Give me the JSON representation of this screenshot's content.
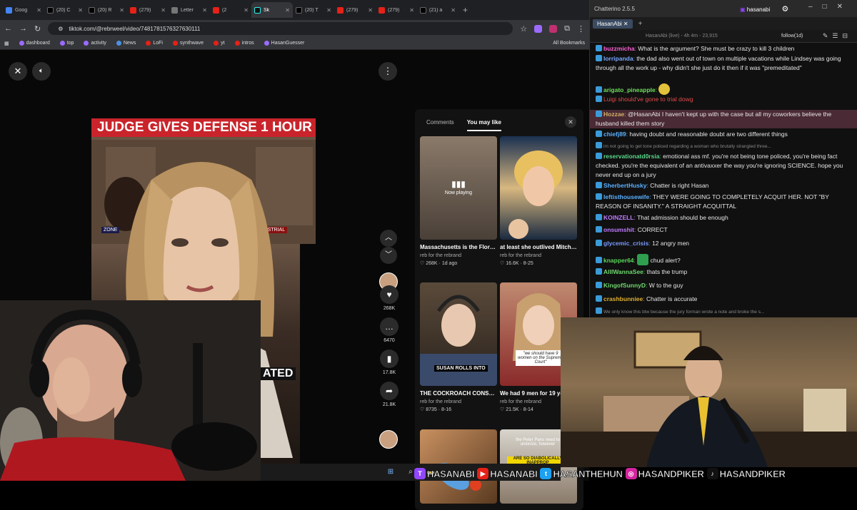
{
  "browser": {
    "tabs": [
      {
        "label": "Goog",
        "fav": "g",
        "icon": "google-icon",
        "active": false
      },
      {
        "label": "(20) C",
        "fav": "x",
        "icon": "x-icon",
        "active": false
      },
      {
        "label": "(20) R",
        "fav": "x",
        "icon": "x-icon",
        "active": false
      },
      {
        "label": "(279)",
        "fav": "yt",
        "icon": "youtube-icon",
        "active": false
      },
      {
        "label": "Letter",
        "fav": "lt",
        "icon": "page-icon",
        "active": false
      },
      {
        "label": "(2",
        "fav": "yt",
        "icon": "youtube-icon",
        "active": false
      },
      {
        "label": "Sk",
        "fav": "tt",
        "icon": "tiktok-icon",
        "active": true
      },
      {
        "label": "(20) T",
        "fav": "x",
        "icon": "x-icon",
        "active": false
      },
      {
        "label": "(279)",
        "fav": "yt",
        "icon": "youtube-icon",
        "active": false
      },
      {
        "label": "(279)",
        "fav": "yt",
        "icon": "youtube-icon",
        "active": false
      },
      {
        "label": "(21) a",
        "fav": "x",
        "icon": "x-icon",
        "active": false
      }
    ],
    "new_tab": "+",
    "url": "tiktok.com/@rebrweel/video/7481781576327630111",
    "bookmarks": [
      {
        "label": "dashboard",
        "color": "#9b6bff"
      },
      {
        "label": "top",
        "color": "#9b6bff"
      },
      {
        "label": "activity",
        "color": "#9b6bff"
      },
      {
        "label": "News",
        "color": "#4a90e2"
      },
      {
        "label": "LoFi",
        "color": "#e62117"
      },
      {
        "label": "synthwave",
        "color": "#e62117"
      },
      {
        "label": "yt",
        "color": "#e62117"
      },
      {
        "label": "intros",
        "color": "#e62117"
      },
      {
        "label": "HasanGuesser",
        "color": "#9b6bff"
      }
    ],
    "all_bookmarks": "All Bookmarks"
  },
  "tiktok": {
    "headline": "JUDGE GIVES DEFENSE 1 HOUR",
    "chyron_left": "ZONE",
    "chyron_right": "ENT MISTRIAL",
    "caption": "ATED",
    "actions": [
      {
        "icon": "heart-icon",
        "count": "268K"
      },
      {
        "icon": "comment-icon",
        "count": "6470"
      },
      {
        "icon": "bookmark-icon",
        "count": "17.8K"
      },
      {
        "icon": "share-icon",
        "count": "21.8K"
      }
    ],
    "panel": {
      "tab_comments": "Comments",
      "tab_you_may_like": "You may like",
      "now_playing": "Now playing",
      "cards": [
        {
          "title": "Massachusetts is the Florida man of crimin...",
          "author": "reb for the rebrand",
          "likes": "268K",
          "date": "1d ago"
        },
        {
          "title": "at least she outlived Mitch McConnell let's...",
          "author": "reb for the rebrand",
          "likes": "16.6K",
          "date": "8-25"
        },
        {
          "title": "THE COCKROACH CONSPIRACY CASE...",
          "author": "reb for the rebrand",
          "likes": "8735",
          "date": "8-16"
        },
        {
          "title": "We had 9 men for 19 years (until 1981)...",
          "author": "reb for the rebrand",
          "likes": "21.5K",
          "date": "8-14"
        }
      ],
      "thumb_texts": {
        "susan": "SUSAN ROLLS INTO",
        "supreme": "\"we should have 9 women on the Supreme Court\"",
        "peter": "the Peter Pans need to unionize, however",
        "diabolical": "ARE SO DIABOLICALLY INAPPROP"
      }
    }
  },
  "chat": {
    "app_title": "Chatterino 2.5.5",
    "user": "hasanabi",
    "tab": "HasanAbi",
    "stream_info": "HasanAbi (live) - 4h 4m - 23,915",
    "follow": "follow(1d)",
    "messages": [
      {
        "user": "buzzmicha",
        "color": "#ff5fd7",
        "text": "What is the argument? She must be crazy to kill 3 children"
      },
      {
        "user": "lorripanda",
        "color": "#7aa7ff",
        "text": "the dad also went out of town on multiple vacations while Lindsey was going through all the work up - why didn't she just do it then if it was \"premeditated\""
      },
      {
        "user": "arigato_pineapple",
        "color": "#6de05b",
        "text": ""
      },
      {
        "user": "",
        "color": "#e04b4b",
        "text": "Luigi should've gone to trial dowg"
      },
      {
        "user": "Hozzae",
        "color": "#d4b06a",
        "text": "@HasanAbi I haven't kept up with the case but all my coworkers believe the husband killed them story"
      },
      {
        "user": "chiefj89",
        "color": "#5ab0ff",
        "text": "having doubt and reasonable doubt are two different things"
      },
      {
        "user": "",
        "color": "#888888",
        "text": "im not going to get tone policed regarding a woman who brutally strangled three..."
      },
      {
        "user": "reservationatd0rsia",
        "color": "#5ad88a",
        "text": "emotional ass mf. you're not being tone policed, you're being fact checked. you're the equivalent of an antivaxxer the way you're ignoring SCIENCE. hope you never end up on a jury"
      },
      {
        "user": "SherbertHusky",
        "color": "#5ab0ff",
        "text": "Chatter is right Hasan"
      },
      {
        "user": "leftisthousewife",
        "color": "#5ab0ff",
        "text": "THEY WERE GOING TO COMPLETELY ACQUIT HER. NOT \"BY REASON OF INSANITY.\" A STRAIGHT ACQUITTAL"
      },
      {
        "user": "KOINZELL",
        "color": "#c07aff",
        "text": "That admission should be enough"
      },
      {
        "user": "onsumshit",
        "color": "#c07aff",
        "text": "CORRECT"
      },
      {
        "user": "glycemic_crisis",
        "color": "#7a9aff",
        "text": "12 angry men"
      },
      {
        "user": "knapper64",
        "color": "#5ad85a",
        "text": "chud alert?"
      },
      {
        "user": "AllIWannaSee",
        "color": "#6ed86e",
        "text": "thats the trump"
      },
      {
        "user": "KingofSunnyD",
        "color": "#6ed86e",
        "text": "W to the guy"
      },
      {
        "user": "crashbunniee",
        "color": "#e0b030",
        "text": "Chatter is accurate"
      },
      {
        "user": "",
        "color": "#888888",
        "text": "We only know this btw because the jury forman wrote a note and broke the s..."
      }
    ]
  },
  "socials": [
    {
      "icon": "twitch-icon",
      "glyph": "T",
      "color": "#9146ff",
      "name": "HASANABI"
    },
    {
      "icon": "youtube-icon",
      "glyph": "▶",
      "color": "#e62117",
      "name": "HASANABI"
    },
    {
      "icon": "twitter-icon",
      "glyph": "t",
      "color": "#1da1f2",
      "name": "HASANTHEHUN"
    },
    {
      "icon": "instagram-icon",
      "glyph": "◎",
      "color": "#d6249f",
      "name": "HASANDPIKER"
    },
    {
      "icon": "tiktok-icon",
      "glyph": "♪",
      "color": "#111111",
      "name": "HASANDPIKER"
    }
  ]
}
